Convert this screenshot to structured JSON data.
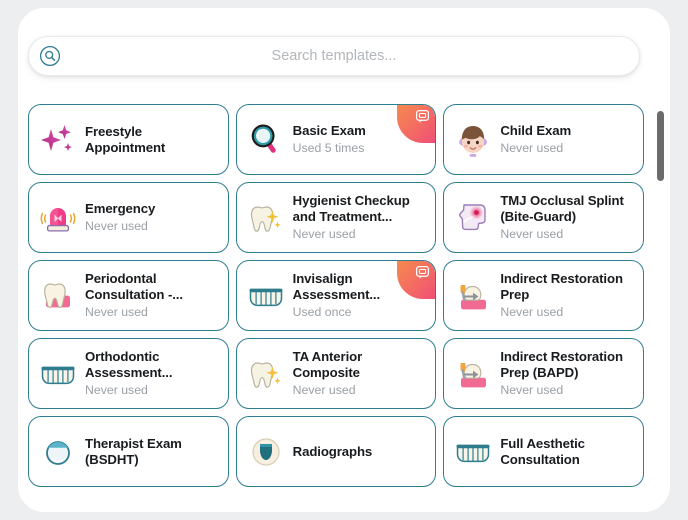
{
  "search": {
    "placeholder": "Search templates...",
    "value": "",
    "icon": "search-icon"
  },
  "colors": {
    "card_border": "#2e7e91",
    "title": "#191c1f",
    "subtitle": "#9aa0a5",
    "badge_gradient_start": "#f68a4e",
    "badge_gradient_end": "#ef4f77",
    "scrollbar_thumb": "#6b6b6b",
    "page_background": "#eceef0",
    "panel_background": "#ffffff"
  },
  "templates": [
    {
      "title": "Freestyle\nAppointment",
      "subtitle": "",
      "icon": "sparkles-icon",
      "badge": false
    },
    {
      "title": "Basic Exam",
      "subtitle": "Used 5 times",
      "icon": "magnifying-glass-icon",
      "badge": true,
      "badge_icon": "chat-note-icon"
    },
    {
      "title": "Child Exam",
      "subtitle": "Never used",
      "icon": "child-face-icon",
      "badge": false
    },
    {
      "title": "Emergency",
      "subtitle": "Never used",
      "icon": "siren-light-icon",
      "badge": false
    },
    {
      "title": "Hygienist Checkup\nand Treatment...",
      "subtitle": "Never used",
      "icon": "sparkling-tooth-icon",
      "badge": false
    },
    {
      "title": "TMJ Occlusal Splint\n(Bite-Guard)",
      "subtitle": "Never used",
      "icon": "head-pain-icon",
      "badge": false
    },
    {
      "title": "Periodontal\nConsultation -...",
      "subtitle": "Never used",
      "icon": "tooth-gums-icon",
      "badge": false
    },
    {
      "title": "Invisalign\nAssessment...",
      "subtitle": "Used once",
      "icon": "aligner-teeth-icon",
      "badge": true,
      "badge_icon": "chat-note-icon"
    },
    {
      "title": "Indirect Restoration\nPrep",
      "subtitle": "Never used",
      "icon": "crown-prep-icon",
      "badge": false
    },
    {
      "title": "Orthodontic\nAssessment...",
      "subtitle": "Never used",
      "icon": "aligner-teeth-icon",
      "badge": false
    },
    {
      "title": "TA Anterior\nComposite",
      "subtitle": "Never used",
      "icon": "sparkling-tooth-icon",
      "badge": false
    },
    {
      "title": "Indirect Restoration\nPrep (BAPD)",
      "subtitle": "Never used",
      "icon": "crown-prep-icon",
      "badge": false
    },
    {
      "title": "Therapist Exam\n(BSDHT)",
      "subtitle": "",
      "icon": "mirror-icon",
      "badge": false
    },
    {
      "title": "Radiographs",
      "subtitle": "",
      "icon": "xray-icon",
      "badge": false
    },
    {
      "title": "Full Aesthetic\nConsultation",
      "subtitle": "",
      "icon": "aligner-teeth-icon",
      "badge": false
    }
  ],
  "scrollbar": {
    "thumb_top_pct": 4,
    "thumb_height_pct": 18
  }
}
